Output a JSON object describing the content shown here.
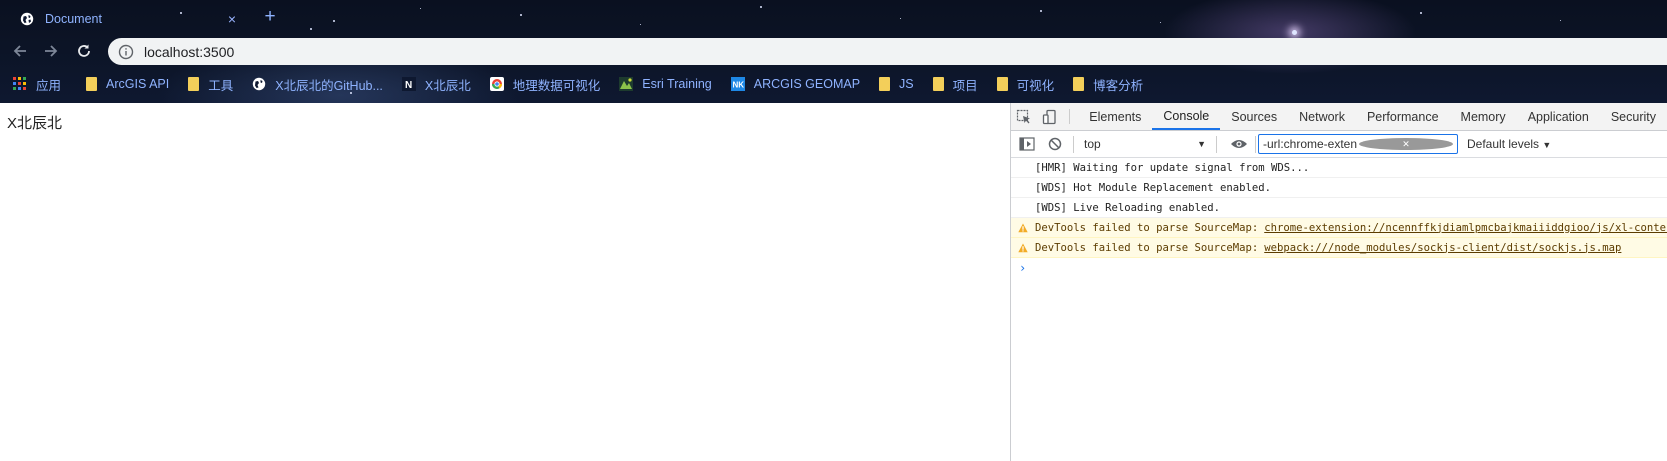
{
  "browser": {
    "tab": {
      "title": "Document",
      "close_glyph": "×"
    },
    "new_tab_glyph": "+",
    "url": "localhost:3500",
    "bookmarks": [
      {
        "label": "应用",
        "icon": "apps-grid-icon"
      },
      {
        "label": "ArcGIS API",
        "icon": "folder-icon"
      },
      {
        "label": "工具",
        "icon": "folder-icon"
      },
      {
        "label": "X北辰北的GitHub...",
        "icon": "globe-icon"
      },
      {
        "label": "X北辰北",
        "icon": "notion-icon"
      },
      {
        "label": "地理数据可视化",
        "icon": "chrome-icon"
      },
      {
        "label": "Esri Training",
        "icon": "esri-icon"
      },
      {
        "label": "ARCGIS GEOMAP",
        "icon": "arcgis-icon"
      },
      {
        "label": "JS",
        "icon": "folder-icon"
      },
      {
        "label": "项目",
        "icon": "folder-icon"
      },
      {
        "label": "可视化",
        "icon": "folder-icon"
      },
      {
        "label": "博客分析",
        "icon": "folder-icon"
      }
    ]
  },
  "page": {
    "text": "X北辰北"
  },
  "devtools": {
    "tabs": [
      "Elements",
      "Console",
      "Sources",
      "Network",
      "Performance",
      "Memory",
      "Application",
      "Security"
    ],
    "active_tab": "Console",
    "context": "top",
    "filter_value": "-url:chrome-extension://ncennffkj",
    "levels": "Default levels",
    "messages": [
      {
        "type": "log",
        "text": "[HMR] Waiting for update signal from WDS..."
      },
      {
        "type": "log",
        "text": "[WDS] Hot Module Replacement enabled."
      },
      {
        "type": "log",
        "text": "[WDS] Live Reloading enabled."
      },
      {
        "type": "warning",
        "text": "DevTools failed to parse SourceMap:",
        "link": "chrome-extension://ncennffkjdiamlpmcbajkmaiiiddgioo/js/xl-content.js.map"
      },
      {
        "type": "warning",
        "text": "DevTools failed to parse SourceMap:",
        "link": "webpack:///node_modules/sockjs-client/dist/sockjs.js.map"
      }
    ],
    "prompt_glyph": "›"
  },
  "colors": {
    "accent": "#1a73e8",
    "link": "#8fb3ff",
    "warn_bg": "#fffbe5"
  }
}
